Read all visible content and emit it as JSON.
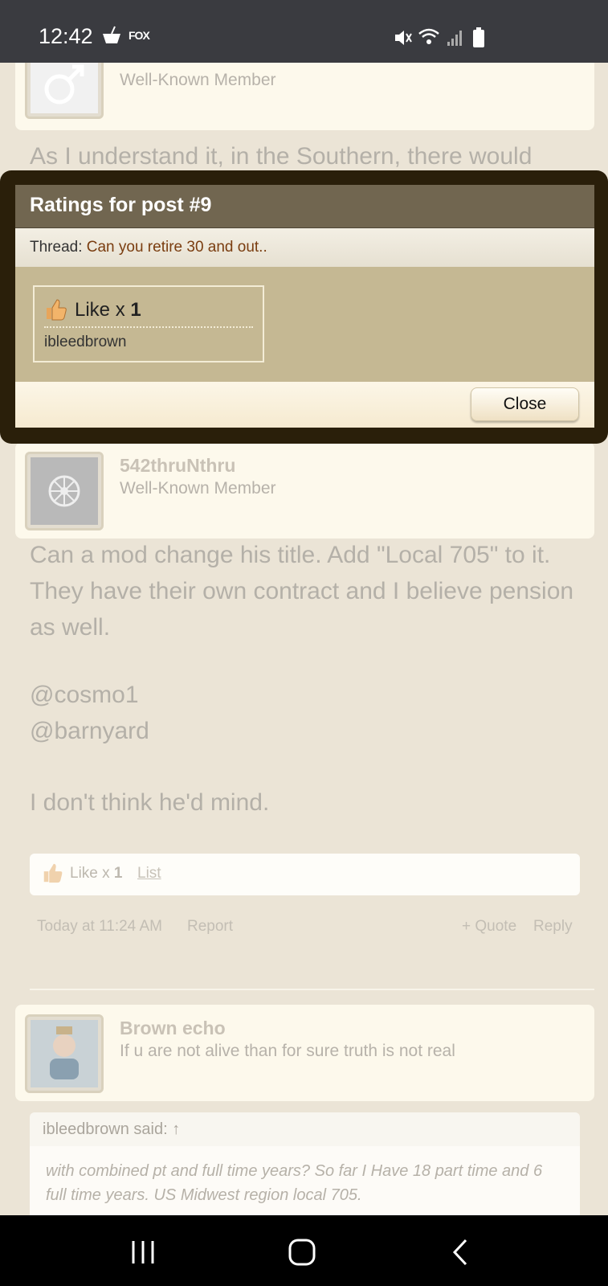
{
  "status_bar": {
    "time": "12:42",
    "notification_icons": [
      "drink-icon",
      "fox-sports-icon"
    ],
    "fox_sports_text": "FOX",
    "system_icons": [
      "mute-icon",
      "wifi-icon",
      "signal-icon",
      "battery-icon"
    ]
  },
  "background": {
    "prev_user": {
      "title": "Well-Known Member"
    },
    "prev_post_partial": "As I understand it, in the Southern, there would",
    "post": {
      "username": "542thruNthru",
      "user_title": "Well-Known Member",
      "paragraphs": [
        "Can a mod change his title. Add \"Local 705\" to it. They have their own contract and I believe pension as well.",
        "@cosmo1",
        "@barnyard",
        "I don't think he'd mind."
      ],
      "likes_text": "Like x",
      "likes_count": "1",
      "list_link": "List",
      "timestamp": "Today at 11:24 AM",
      "report": "Report",
      "quote": "+ Quote",
      "reply": "Reply"
    },
    "next_post": {
      "username": "Brown echo",
      "user_title": "If u are not alive than for sure truth is not real",
      "quote_author": "ibleedbrown said: ↑",
      "quote_text": "with combined pt and full time years? So far I Have 18 part time and 6 full time years. US Midwest region local 705."
    }
  },
  "dialog": {
    "title": "Ratings for post #9",
    "thread_label": "Thread:",
    "thread_link": "Can you retire 30 and out..",
    "rating_name": "Like x",
    "rating_count": "1",
    "rater": "ibleedbrown",
    "close_label": "Close"
  },
  "nav_bar": {
    "buttons": [
      "recent-apps",
      "home",
      "back"
    ]
  },
  "colors": {
    "dialog_frame": "#2a1f0a",
    "title_bar": "#716650",
    "body": "#c5b893",
    "thread_link": "#7a3d10"
  }
}
